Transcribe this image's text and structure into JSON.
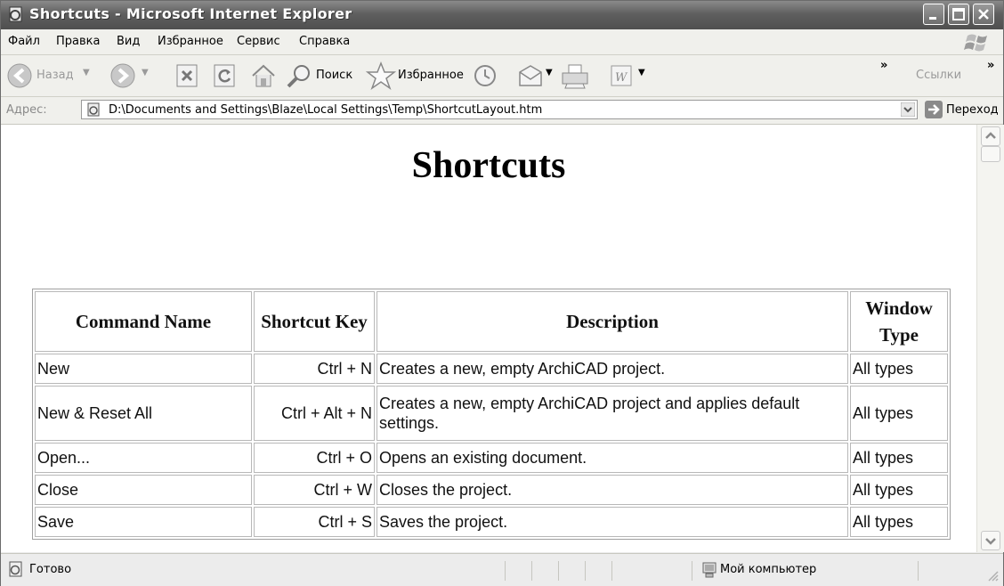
{
  "window": {
    "title": "Shortcuts - Microsoft Internet Explorer"
  },
  "menu": [
    {
      "label": "Файл"
    },
    {
      "label": "Правка"
    },
    {
      "label": "Вид"
    },
    {
      "label": "Избранное"
    },
    {
      "label": "Сервис"
    },
    {
      "label": "Справка"
    }
  ],
  "toolbar": {
    "back": "Назад",
    "search": "Поиск",
    "favorites": "Избранное",
    "chevron1": "»",
    "links": "Ссылки",
    "chevron2": "»"
  },
  "address": {
    "label": "Адрес:",
    "url": "D:\\Documents and Settings\\Blaze\\Local Settings\\Temp\\ShortcutLayout.htm",
    "go": "Переход"
  },
  "page": {
    "heading": "Shortcuts",
    "columns": [
      "Command Name",
      "Shortcut Key",
      "Description",
      "Window Type"
    ],
    "rows": [
      {
        "name": "New",
        "key": "Ctrl + N",
        "desc": "Creates a new, empty ArchiCAD project.",
        "type": "All types"
      },
      {
        "name": "New & Reset All",
        "key": "Ctrl + Alt + N",
        "desc": "Creates a new, empty ArchiCAD project and applies default settings.",
        "type": "All types"
      },
      {
        "name": "Open...",
        "key": "Ctrl + O",
        "desc": "Opens an existing document.",
        "type": "All types"
      },
      {
        "name": "Close",
        "key": "Ctrl + W",
        "desc": "Closes the project.",
        "type": "All types"
      },
      {
        "name": "Save",
        "key": "Ctrl + S",
        "desc": "Saves the project.",
        "type": "All types"
      }
    ]
  },
  "status": {
    "text": "Готово",
    "zone": "Мой компьютер"
  }
}
